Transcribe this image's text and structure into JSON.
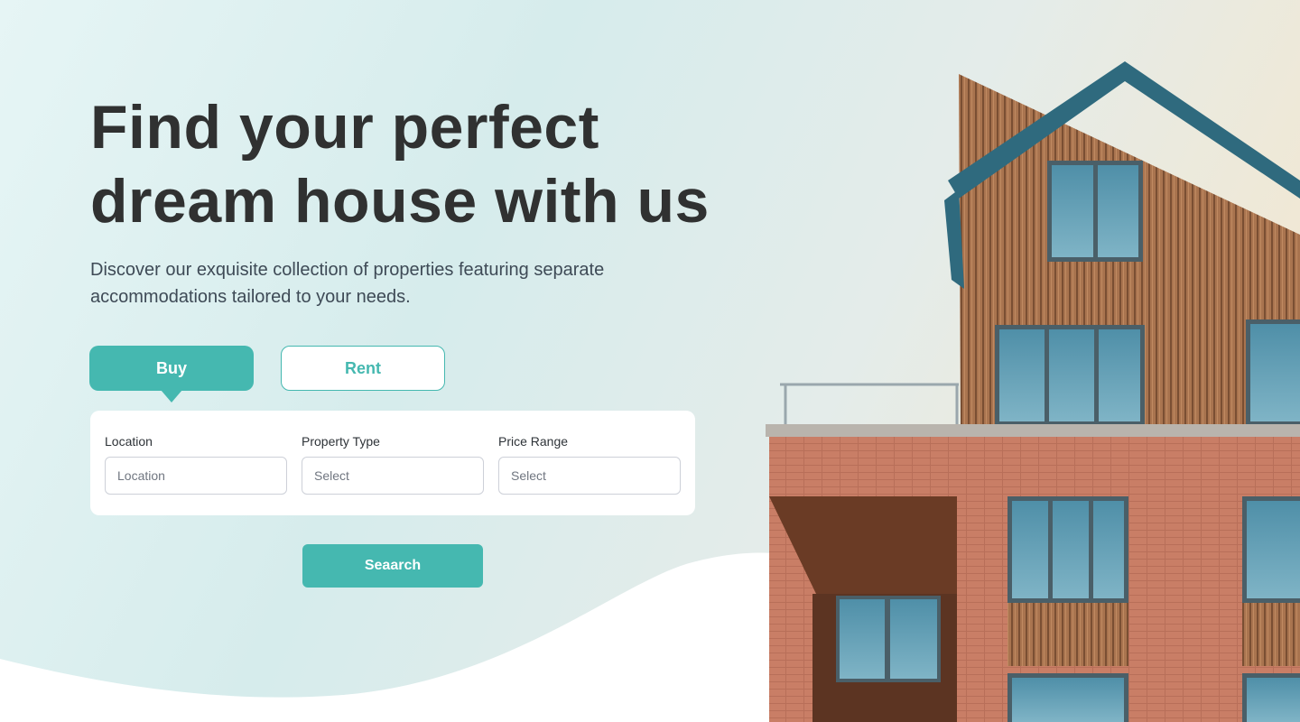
{
  "hero": {
    "title_line1": "Find your perfect",
    "title_line2": "dream house with us",
    "subtitle": "Discover our exquisite collection of properties featuring separate accommodations tailored to your needs."
  },
  "tabs": [
    {
      "label": "Buy",
      "active": true
    },
    {
      "label": "Rent",
      "active": false
    }
  ],
  "search": {
    "fields": [
      {
        "label": "Location",
        "placeholder": "Location"
      },
      {
        "label": "Property Type",
        "value": "Select"
      },
      {
        "label": "Price Range",
        "value": "Select"
      }
    ],
    "button_label": "Seaarch"
  },
  "colors": {
    "accent": "#45b8b0",
    "heading": "#303131",
    "body_text": "#3e4a56",
    "card_bg": "#ffffff"
  }
}
